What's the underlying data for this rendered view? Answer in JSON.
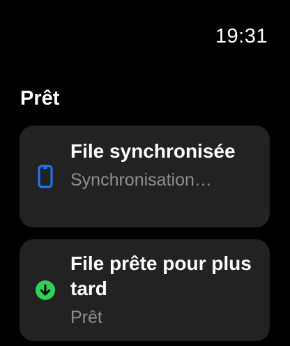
{
  "status_bar": {
    "time": "19:31"
  },
  "section": {
    "title": "Prêt"
  },
  "items": [
    {
      "title": "File synchronisée",
      "subtitle": "Synchronisation…",
      "icon": "phone-icon",
      "icon_color": "#1a7cff"
    },
    {
      "title": "File prête pour plus tard",
      "subtitle": "Prêt",
      "icon": "download-arrow-circle-icon",
      "icon_color": "#30d158"
    }
  ],
  "colors": {
    "background": "#000000",
    "card": "#222222",
    "subtitle": "#8e8e93"
  }
}
